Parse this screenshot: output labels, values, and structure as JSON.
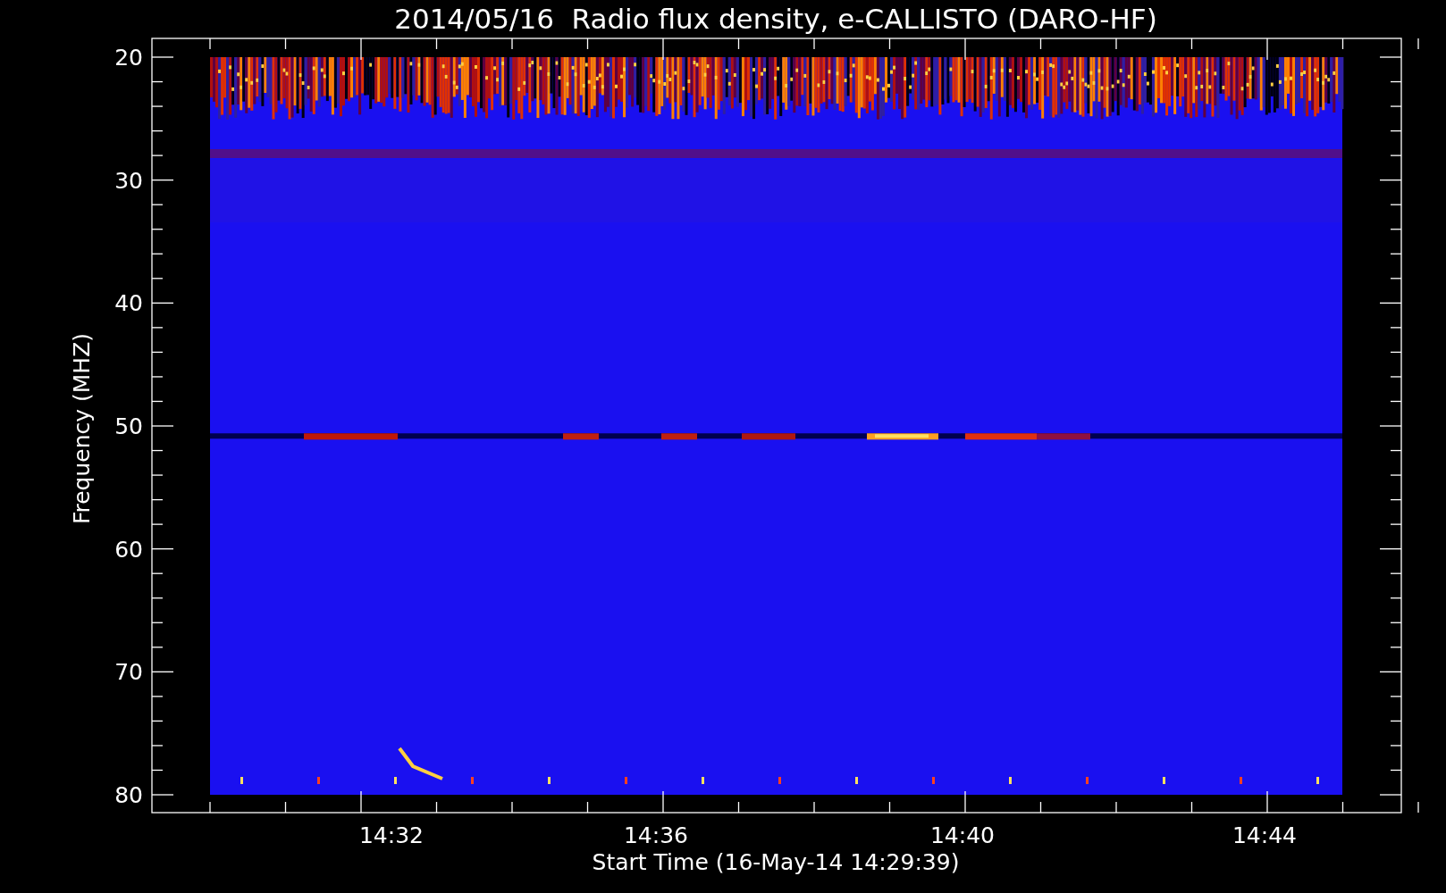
{
  "title": "2014/05/16  Radio flux density, e-CALLISTO (DARO-HF)",
  "plot": {
    "xlabel": "Start Time (16-May-14 14:29:39)",
    "ylabel": "Frequency (MHZ)",
    "yticks": [
      "20",
      "30",
      "40",
      "50",
      "60",
      "70",
      "80"
    ],
    "xticks": [
      "14:32",
      "14:36",
      "14:40",
      "14:44"
    ]
  }
}
